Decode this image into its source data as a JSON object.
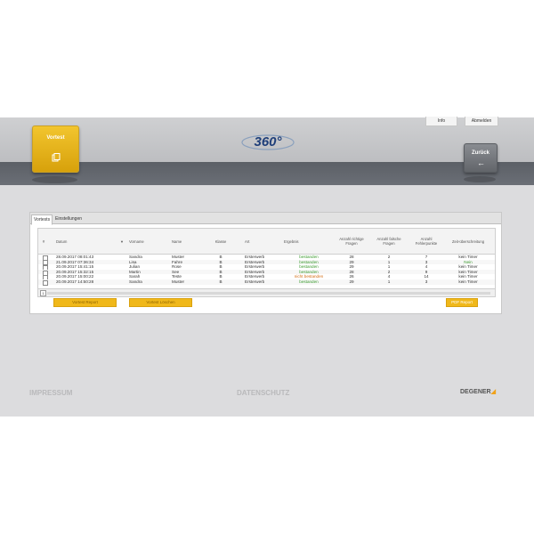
{
  "header": {
    "info_label": "Info",
    "logout_label": "Abmelden",
    "vortest_label": "Vortest",
    "logo_text": "360°",
    "back_label": "Zurück"
  },
  "tabs": [
    {
      "label": "Vortests"
    },
    {
      "label": "Einstellungen"
    }
  ],
  "table": {
    "headers": {
      "num": "#",
      "datum": "Datum",
      "vorname": "Vorname",
      "name": "Name",
      "klasse": "Klasse",
      "art": "Art",
      "ergebnis": "Ergebnis",
      "richtige": "Anzahl richtige Fragen",
      "falsche": "Anzahl falsche Fragen",
      "fehler": "Anzahl Fehlerpunkte",
      "zeit": "Zeit-überschreitung"
    },
    "rows": [
      {
        "datum": "28.09.2017 08:01:43",
        "vorname": "Sandra",
        "name": "Muster",
        "klasse": "B",
        "art": "Ersterwerb",
        "ergebnis": "bestanden",
        "status": "ok",
        "richtige": "28",
        "falsche": "2",
        "fehler": "7",
        "zeit": "kein Timer"
      },
      {
        "datum": "21.09.2017 07:36:34",
        "vorname": "Lisa",
        "name": "Fahre",
        "klasse": "B",
        "art": "Ersterwerb",
        "ergebnis": "bestanden",
        "status": "ok",
        "richtige": "29",
        "falsche": "1",
        "fehler": "3",
        "zeit": "Nein"
      },
      {
        "datum": "20.09.2017 15:41:15",
        "vorname": "Julian",
        "name": "Rose",
        "klasse": "B",
        "art": "Ersterwerb",
        "ergebnis": "bestanden",
        "status": "ok",
        "richtige": "29",
        "falsche": "1",
        "fehler": "4",
        "zeit": "kein Timer"
      },
      {
        "datum": "20.09.2017 15:32:15",
        "vorname": "Martin",
        "name": "See",
        "klasse": "B",
        "art": "Ersterwerb",
        "ergebnis": "bestanden",
        "status": "ok",
        "richtige": "28",
        "falsche": "2",
        "fehler": "9",
        "zeit": "kein Timer"
      },
      {
        "datum": "20.09.2017 15:00:22",
        "vorname": "Sarah",
        "name": "Teste",
        "klasse": "B",
        "art": "Ersterwerb",
        "ergebnis": "nicht bestanden",
        "status": "fail",
        "richtige": "26",
        "falsche": "4",
        "fehler": "14",
        "zeit": "kein Timer"
      },
      {
        "datum": "20.09.2017 14:50:28",
        "vorname": "Sandra",
        "name": "Muster",
        "klasse": "B",
        "art": "Ersterwerb",
        "ergebnis": "bestanden",
        "status": "ok",
        "richtige": "29",
        "falsche": "1",
        "fehler": "3",
        "zeit": "kein Timer"
      }
    ],
    "page": "1"
  },
  "buttons": {
    "report": "Vortest Report",
    "delete": "Vortest Löschen",
    "pdf": "PDF Report"
  },
  "footer": {
    "impressum": "IMPRESSUM",
    "datenschutz": "DATENSCHUTZ",
    "brand": "DEGENER"
  },
  "colors": {
    "accent_yellow": "#f0b81a",
    "pass_green": "#3a9a2d",
    "fail_orange": "#d46c12",
    "header_dark": "#5b5f66"
  }
}
